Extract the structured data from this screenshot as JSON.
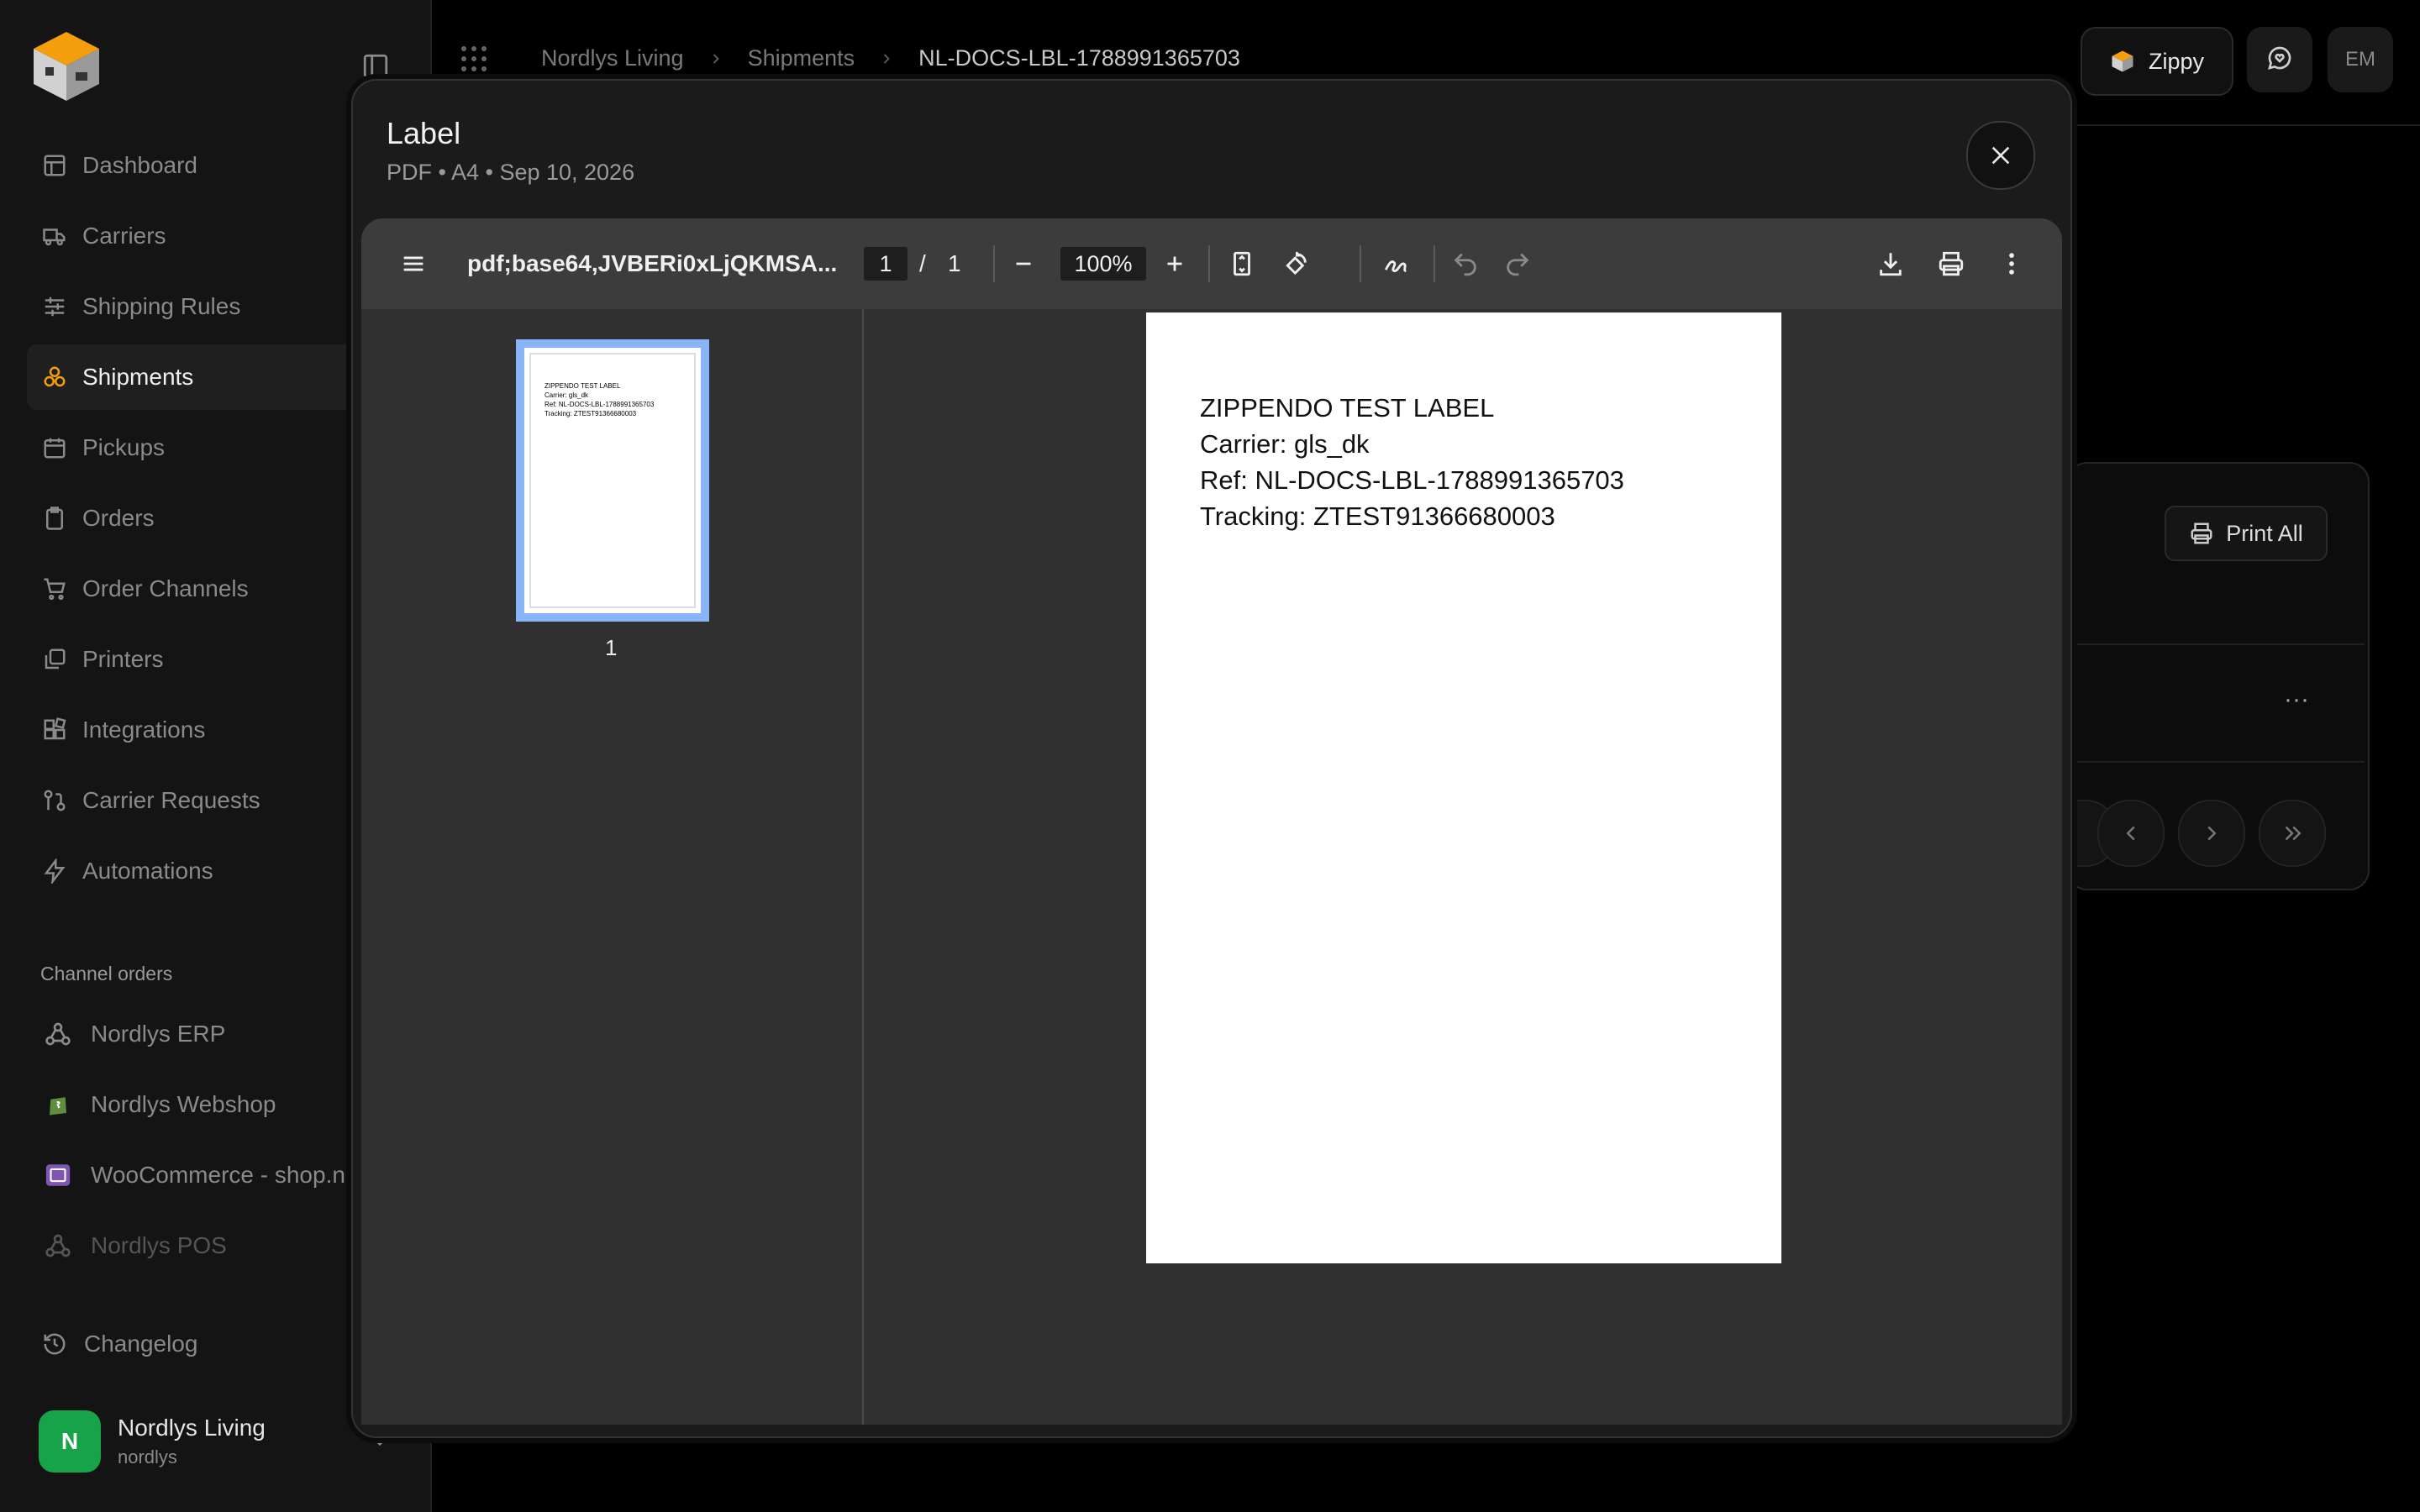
{
  "sidebar": {
    "nav": [
      {
        "label": "Dashboard",
        "icon": "dashboard-icon"
      },
      {
        "label": "Carriers",
        "icon": "truck-icon"
      },
      {
        "label": "Shipping Rules",
        "icon": "sliders-icon"
      },
      {
        "label": "Shipments",
        "icon": "boxes-icon",
        "active": true
      },
      {
        "label": "Pickups",
        "icon": "calendar-icon"
      },
      {
        "label": "Orders",
        "icon": "clipboard-icon"
      },
      {
        "label": "Order Channels",
        "icon": "cart-icon"
      },
      {
        "label": "Printers",
        "icon": "printer-stack-icon"
      },
      {
        "label": "Integrations",
        "icon": "blocks-icon"
      },
      {
        "label": "Carrier Requests",
        "icon": "git-pull-icon"
      },
      {
        "label": "Automations",
        "icon": "bolt-icon"
      }
    ],
    "channels_label": "Channel orders",
    "channels": [
      {
        "label": "Nordlys ERP",
        "icon": "webhook-icon"
      },
      {
        "label": "Nordlys Webshop",
        "icon": "shopify-icon"
      },
      {
        "label": "WooCommerce - shop.no",
        "icon": "woocommerce-icon"
      },
      {
        "label": "Nordlys POS",
        "icon": "webhook-icon",
        "dim": true
      }
    ],
    "changelog": "Changelog",
    "account": {
      "initial": "N",
      "name": "Nordlys Living",
      "slug": "nordlys"
    }
  },
  "topbar": {
    "breadcrumbs": [
      "Nordlys Living",
      "Shipments",
      "NL-DOCS-LBL-1788991365703"
    ],
    "assistant_label": "Zippy",
    "user_initials": "EM"
  },
  "background": {
    "print_all_label": "Print All",
    "more": "···"
  },
  "modal": {
    "title": "Label",
    "subtitle": "PDF • A4 • Sep 10, 2026",
    "viewer": {
      "filename": "pdf;base64,JVBERi0xLjQKMSA...",
      "current_page": "1",
      "page_slash": "/",
      "total_pages": "1",
      "zoom": "100%",
      "thumb_label": "1",
      "document_lines": [
        "ZIPPENDO TEST LABEL",
        "Carrier: gls_dk",
        "Ref: NL-DOCS-LBL-1788991365703",
        "Tracking: ZTEST91366680003"
      ]
    }
  },
  "colors": {
    "accent_orange": "#f59e0b",
    "thumb_border": "#8ab4f8",
    "avatar_green": "#16a34a"
  }
}
